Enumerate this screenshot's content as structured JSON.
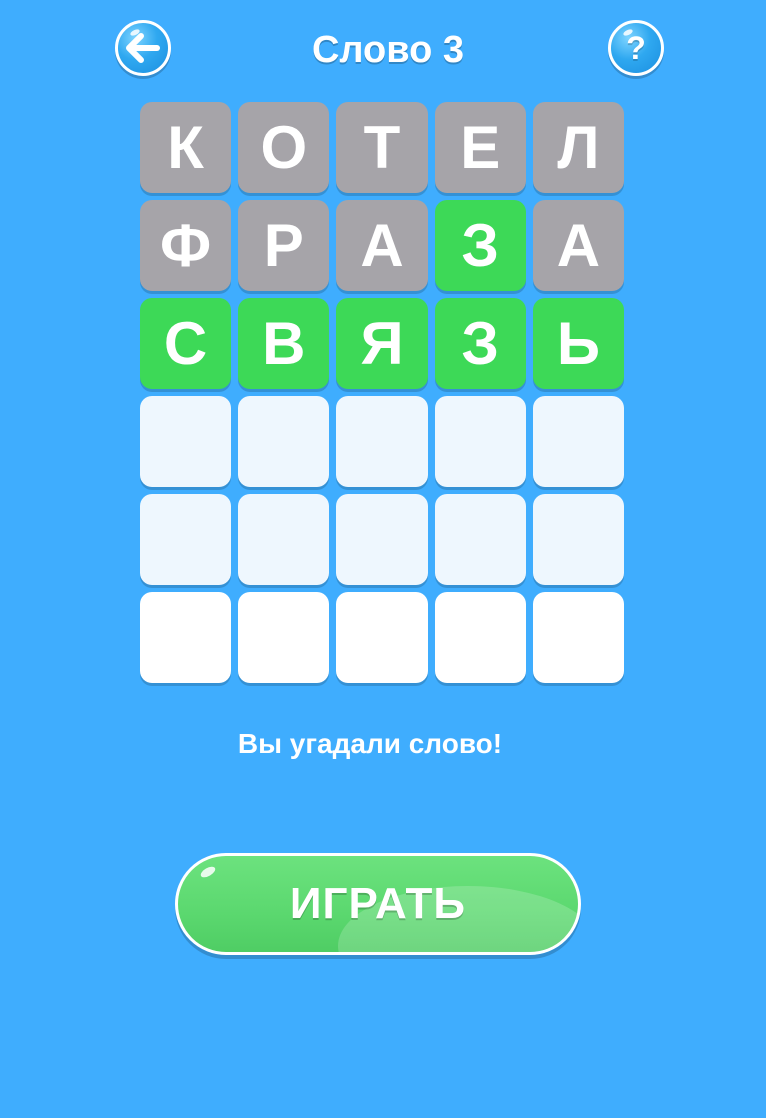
{
  "header": {
    "title": "Слово 3",
    "back_icon": "arrow-left-icon",
    "help_label": "?",
    "help_icon": "question-icon"
  },
  "grid": {
    "rows": [
      [
        {
          "letter": "К",
          "state": "absent"
        },
        {
          "letter": "О",
          "state": "absent"
        },
        {
          "letter": "Т",
          "state": "absent"
        },
        {
          "letter": "Е",
          "state": "absent"
        },
        {
          "letter": "Л",
          "state": "absent"
        }
      ],
      [
        {
          "letter": "Ф",
          "state": "absent"
        },
        {
          "letter": "Р",
          "state": "absent"
        },
        {
          "letter": "А",
          "state": "absent"
        },
        {
          "letter": "З",
          "state": "correct"
        },
        {
          "letter": "А",
          "state": "absent"
        }
      ],
      [
        {
          "letter": "С",
          "state": "correct"
        },
        {
          "letter": "В",
          "state": "correct"
        },
        {
          "letter": "Я",
          "state": "correct"
        },
        {
          "letter": "З",
          "state": "correct"
        },
        {
          "letter": "Ь",
          "state": "correct"
        }
      ],
      [
        {
          "letter": "",
          "state": "empty"
        },
        {
          "letter": "",
          "state": "empty"
        },
        {
          "letter": "",
          "state": "empty"
        },
        {
          "letter": "",
          "state": "empty"
        },
        {
          "letter": "",
          "state": "empty"
        }
      ],
      [
        {
          "letter": "",
          "state": "empty"
        },
        {
          "letter": "",
          "state": "empty"
        },
        {
          "letter": "",
          "state": "empty"
        },
        {
          "letter": "",
          "state": "empty"
        },
        {
          "letter": "",
          "state": "empty"
        }
      ],
      [
        {
          "letter": "",
          "state": "empty"
        },
        {
          "letter": "",
          "state": "empty"
        },
        {
          "letter": "",
          "state": "empty"
        },
        {
          "letter": "",
          "state": "empty"
        },
        {
          "letter": "",
          "state": "empty"
        }
      ]
    ]
  },
  "message": "Вы угадали слово!",
  "play_button": {
    "label": "ИГРАТЬ"
  },
  "colors": {
    "background": "#3fadfe",
    "absent": "#a6a4a9",
    "correct": "#3dd957",
    "empty": "#eef7fe",
    "play_button": "#5bd86f"
  }
}
